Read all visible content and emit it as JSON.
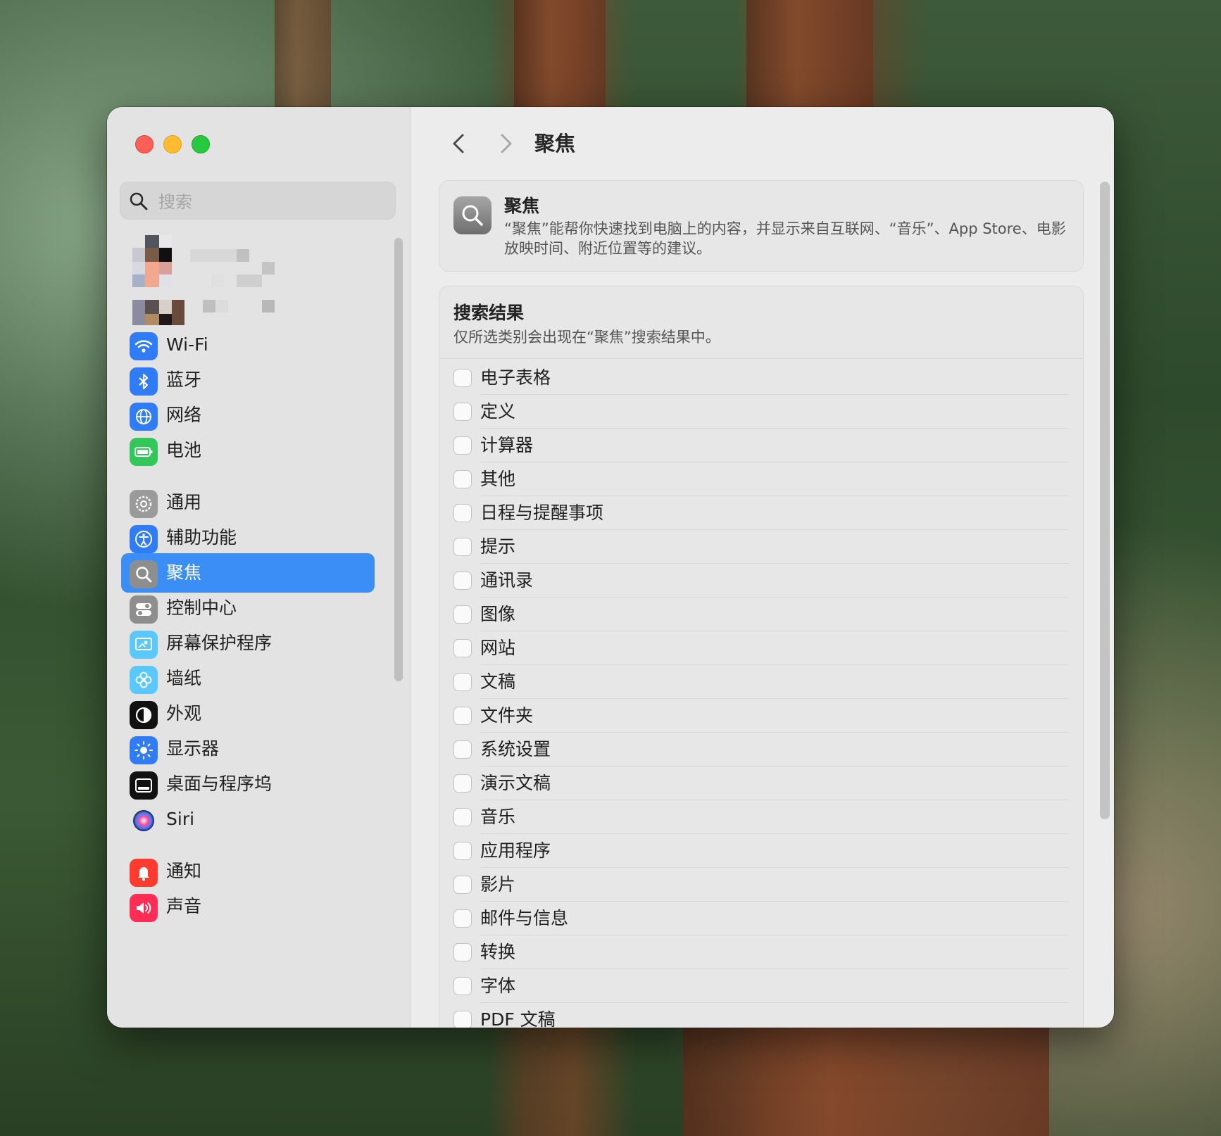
{
  "window": {
    "title": "聚焦"
  },
  "sidebar": {
    "search_placeholder": "搜索",
    "items": [
      {
        "label": "Wi-Fi",
        "icon": "wifi-icon",
        "color": "#2f7cf6"
      },
      {
        "label": "蓝牙",
        "icon": "bluetooth-icon",
        "color": "#2f7cf6"
      },
      {
        "label": "网络",
        "icon": "globe-icon",
        "color": "#2f7cf6"
      },
      {
        "label": "电池",
        "icon": "battery-icon",
        "color": "#32c759"
      },
      {
        "label": "通用",
        "icon": "gear-icon",
        "color": "#9a9a9a"
      },
      {
        "label": "辅助功能",
        "icon": "accessibility-icon",
        "color": "#2f7cf6"
      },
      {
        "label": "聚焦",
        "icon": "magnifier-icon",
        "color": "#8e8e8e",
        "active": true
      },
      {
        "label": "控制中心",
        "icon": "toggles-icon",
        "color": "#8e8e8e"
      },
      {
        "label": "屏幕保护程序",
        "icon": "screensaver-icon",
        "color": "#5ac8fa"
      },
      {
        "label": "墙纸",
        "icon": "flower-icon",
        "color": "#5ac8fa"
      },
      {
        "label": "外观",
        "icon": "appearance-icon",
        "color": "#111111"
      },
      {
        "label": "显示器",
        "icon": "brightness-icon",
        "color": "#2f7cf6"
      },
      {
        "label": "桌面与程序坞",
        "icon": "dock-icon",
        "color": "#111111"
      },
      {
        "label": "Siri",
        "icon": "siri-icon",
        "color": "#222244"
      },
      {
        "label": "通知",
        "icon": "bell-icon",
        "color": "#ff3b30"
      },
      {
        "label": "声音",
        "icon": "speaker-icon",
        "color": "#ff2d55"
      }
    ]
  },
  "header": {
    "title": "聚焦"
  },
  "intro": {
    "title": "聚焦",
    "description": "“聚焦”能帮你快速找到电脑上的内容，并显示来自互联网、“音乐”、App Store、电影放映时间、附近位置等的建议。"
  },
  "results": {
    "title": "搜索结果",
    "subtitle": "仅所选类别会出现在“聚焦”搜索结果中。",
    "categories": [
      {
        "label": "电子表格",
        "checked": false
      },
      {
        "label": "定义",
        "checked": false
      },
      {
        "label": "计算器",
        "checked": false
      },
      {
        "label": "其他",
        "checked": false
      },
      {
        "label": "日程与提醒事项",
        "checked": false
      },
      {
        "label": "提示",
        "checked": false
      },
      {
        "label": "通讯录",
        "checked": false
      },
      {
        "label": "图像",
        "checked": false
      },
      {
        "label": "网站",
        "checked": false
      },
      {
        "label": "文稿",
        "checked": false
      },
      {
        "label": "文件夹",
        "checked": false
      },
      {
        "label": "系统设置",
        "checked": false
      },
      {
        "label": "演示文稿",
        "checked": false
      },
      {
        "label": "音乐",
        "checked": false
      },
      {
        "label": "应用程序",
        "checked": false
      },
      {
        "label": "影片",
        "checked": false
      },
      {
        "label": "邮件与信息",
        "checked": false
      },
      {
        "label": "转换",
        "checked": false
      },
      {
        "label": "字体",
        "checked": false
      },
      {
        "label": "PDF 文稿",
        "checked": false
      }
    ]
  },
  "colors": {
    "accent": "#3a8ef5",
    "close": "#fe5f57",
    "minimize": "#febc2e",
    "zoom": "#28c840"
  }
}
